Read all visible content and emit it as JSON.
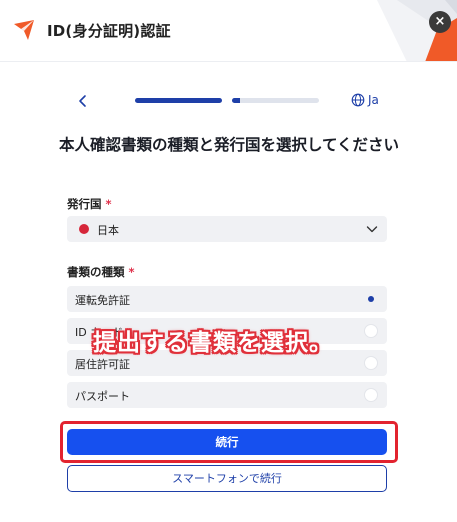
{
  "header": {
    "title": "ID(身分証明)認証",
    "close_label": "×",
    "logo_icon": "paper-plane-logo",
    "accent": "#f05a28"
  },
  "nav": {
    "back_icon": "chevron-left-icon",
    "progress": {
      "step1": 1.0,
      "step2": 0.09
    },
    "lang_icon": "globe-icon",
    "lang_label": "Ja"
  },
  "main": {
    "title": "本人確認書類の種類と発行国を選択してください",
    "country": {
      "label": "発行国",
      "required_mark": "*",
      "value": "日本"
    },
    "doc_type": {
      "label": "書類の種類",
      "required_mark": "*",
      "options": [
        {
          "label": "運転免許証",
          "selected": true
        },
        {
          "label": "ID カード",
          "selected": false
        },
        {
          "label": "居住許可証",
          "selected": false
        },
        {
          "label": "パスポート",
          "selected": false
        }
      ]
    },
    "continue_label": "続行",
    "phone_label": "スマートフォンで続行"
  },
  "annotation": {
    "text": "提出する書類を選択。"
  },
  "colors": {
    "primary": "#1650ef",
    "navy": "#1e3fa8",
    "annotation_red": "#e2232f"
  }
}
